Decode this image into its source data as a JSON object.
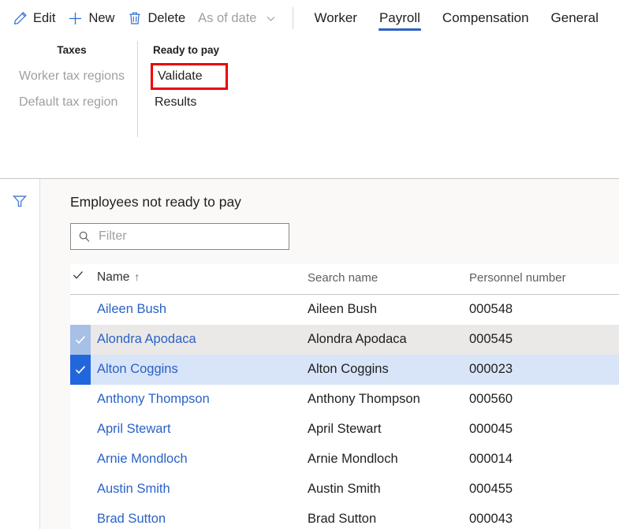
{
  "command_bar": {
    "buttons": [
      {
        "label": "Edit",
        "icon": "pencil-icon",
        "disabled": false,
        "has_chevron": false,
        "name": "edit-button"
      },
      {
        "label": "New",
        "icon": "plus-icon",
        "disabled": false,
        "has_chevron": false,
        "name": "new-button"
      },
      {
        "label": "Delete",
        "icon": "trash-icon",
        "disabled": false,
        "has_chevron": false,
        "name": "delete-button"
      },
      {
        "label": "As of date",
        "icon": "none",
        "disabled": true,
        "has_chevron": true,
        "name": "as-of-date-button"
      }
    ],
    "tabs": [
      {
        "label": "Worker",
        "active": false,
        "name": "tab-worker"
      },
      {
        "label": "Payroll",
        "active": true,
        "name": "tab-payroll"
      },
      {
        "label": "Compensation",
        "active": false,
        "name": "tab-compensation"
      },
      {
        "label": "General",
        "active": false,
        "name": "tab-general"
      }
    ],
    "active_tab_color": "#2b62c6"
  },
  "action_pane": {
    "groups": [
      {
        "title": "Taxes",
        "name": "action-group-taxes",
        "divider": false,
        "items": [
          {
            "label": "Worker tax regions",
            "disabled": true,
            "highlighted": false,
            "name": "worker-tax-regions-item"
          },
          {
            "label": "Default tax region",
            "disabled": true,
            "highlighted": false,
            "name": "default-tax-region-item"
          }
        ]
      },
      {
        "title": "Ready to pay",
        "name": "action-group-ready-to-pay",
        "divider": true,
        "items": [
          {
            "label": "Validate",
            "disabled": false,
            "highlighted": true,
            "name": "validate-button"
          },
          {
            "label": "Results",
            "disabled": false,
            "highlighted": false,
            "name": "results-button"
          }
        ]
      }
    ],
    "highlight_color": "#ee0000"
  },
  "bottom": {
    "filter_rail": {
      "icon": "funnel-icon",
      "name": "filter-pane-toggle"
    },
    "caption": "Employees not ready to pay",
    "filter": {
      "placeholder": "Filter",
      "value": "",
      "icon": "search-icon"
    },
    "table": {
      "select_all_icon": "checkmark-icon",
      "columns": [
        {
          "label": "",
          "name": "column-select"
        },
        {
          "label": "Name",
          "name": "column-name",
          "sorted": true,
          "sort_arrow": "↑"
        },
        {
          "label": "Search name",
          "name": "column-search-name"
        },
        {
          "label": "Personnel number",
          "name": "column-personnel-number"
        }
      ],
      "rows": [
        {
          "name": "Aileen Bush",
          "search_name": "Aileen Bush",
          "personnel_number": "000548",
          "state": "none"
        },
        {
          "name": "Alondra Apodaca",
          "search_name": "Alondra Apodaca",
          "personnel_number": "000545",
          "state": "hover"
        },
        {
          "name": "Alton Coggins",
          "search_name": "Alton Coggins",
          "personnel_number": "000023",
          "state": "selected"
        },
        {
          "name": "Anthony Thompson",
          "search_name": "Anthony Thompson",
          "personnel_number": "000560",
          "state": "none"
        },
        {
          "name": "April Stewart",
          "search_name": "April Stewart",
          "personnel_number": "000045",
          "state": "none"
        },
        {
          "name": "Arnie Mondloch",
          "search_name": "Arnie Mondloch",
          "personnel_number": "000014",
          "state": "none"
        },
        {
          "name": "Austin Smith",
          "search_name": "Austin Smith",
          "personnel_number": "000455",
          "state": "none"
        },
        {
          "name": "Brad Sutton",
          "search_name": "Brad Sutton",
          "personnel_number": "000043",
          "state": "none"
        }
      ],
      "link_color": "#2b62c6",
      "hover_row_color": "#eae9e8",
      "selected_row_color": "#d8e4f8",
      "checkbox_partial_color": "#a6c0e6",
      "checkbox_full_color": "#2266dd"
    }
  }
}
